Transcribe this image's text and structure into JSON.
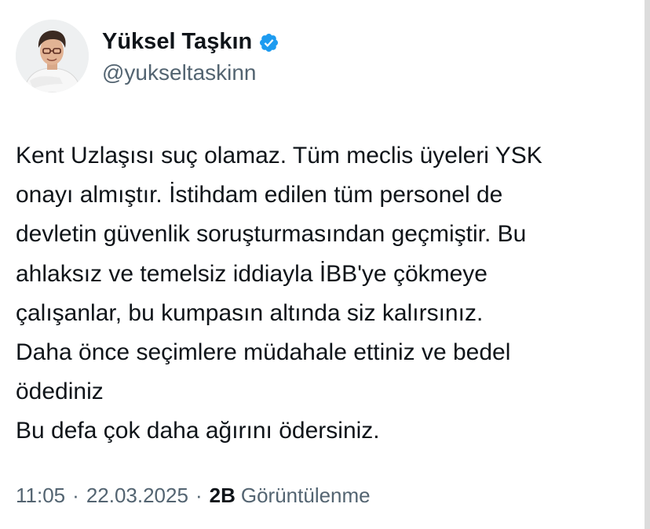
{
  "tweet": {
    "author": {
      "display_name": "Yüksel Taşkın",
      "handle": "@yukseltaskinn",
      "verified": true,
      "verified_icon": "verified-badge-icon",
      "avatar_icon": "profile-avatar"
    },
    "text_lines": [
      "Kent Uzlaşısı suç olamaz. Tüm meclis üyeleri YSK",
      "onayı almıştır. İstihdam edilen tüm personel de",
      "devletin güvenlik soruşturmasından geçmiştir. Bu",
      "ahlaksız ve temelsiz iddiayla İBB'ye çökmeye",
      "çalışanlar, bu kumpasın altında siz kalırsınız.",
      "Daha önce seçimlere müdahale ettiniz ve bedel",
      "ödediniz",
      "Bu defa çok daha ağırını ödersiniz."
    ],
    "meta": {
      "time": "11:05",
      "separator": "·",
      "date": "22.03.2025",
      "views_count": "2B",
      "views_label": "Görüntülenme"
    }
  },
  "colors": {
    "text_primary": "#0f1419",
    "text_secondary": "#536471",
    "verified_blue": "#1d9bf0",
    "background": "#ffffff"
  }
}
